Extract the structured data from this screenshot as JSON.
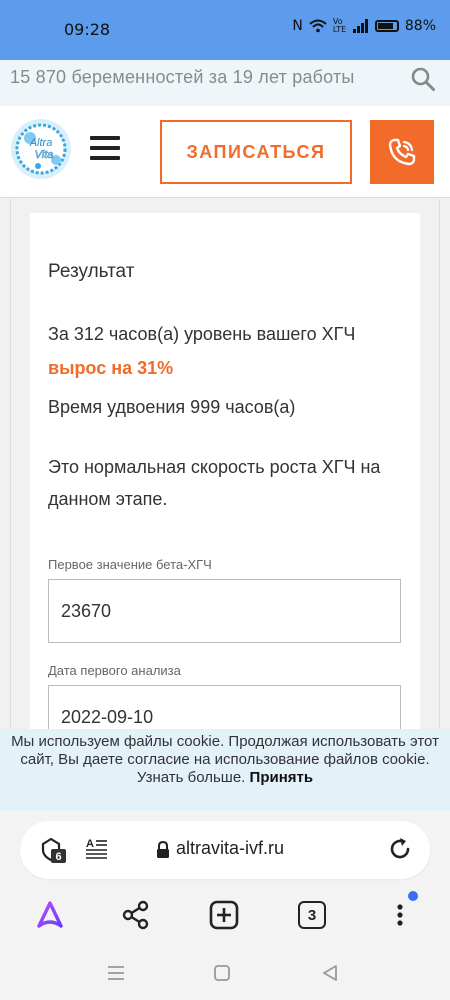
{
  "status_bar": {
    "time": "09:28",
    "battery": "88%",
    "network": "Vo LTE"
  },
  "tagline": {
    "text": "15 870 беременностей за 19 лет работы"
  },
  "header": {
    "logo_text_top": "Altra",
    "logo_text_bottom": "Vita",
    "signup_label": "ЗАПИСАТЬСЯ"
  },
  "result": {
    "heading": "Результат",
    "line1": "За 312 часов(а) уровень вашего ХГЧ",
    "growth": "вырос на 31%",
    "doubling": "Время удвоения 999 часов(а)",
    "verdict": "Это нормальная скорость роста ХГЧ на данном этапе."
  },
  "form": {
    "first_value_label": "Первое значение бета-ХГЧ",
    "first_value": "23670",
    "first_date_label": "Дата первого анализа",
    "first_date": "2022-09-10"
  },
  "cookie": {
    "text": "Мы используем файлы cookie. Продолжая использовать этот сайт, Вы даете согласие на использование файлов cookie. Узнать больше.",
    "accept": "Принять"
  },
  "browser": {
    "url": "altravita-ivf.ru",
    "shield_count": "6",
    "tabs_count": "3"
  },
  "colors": {
    "accent": "#f26b2a",
    "status_bar": "#5d9cec",
    "cookie_bg": "#e3f1f9"
  }
}
